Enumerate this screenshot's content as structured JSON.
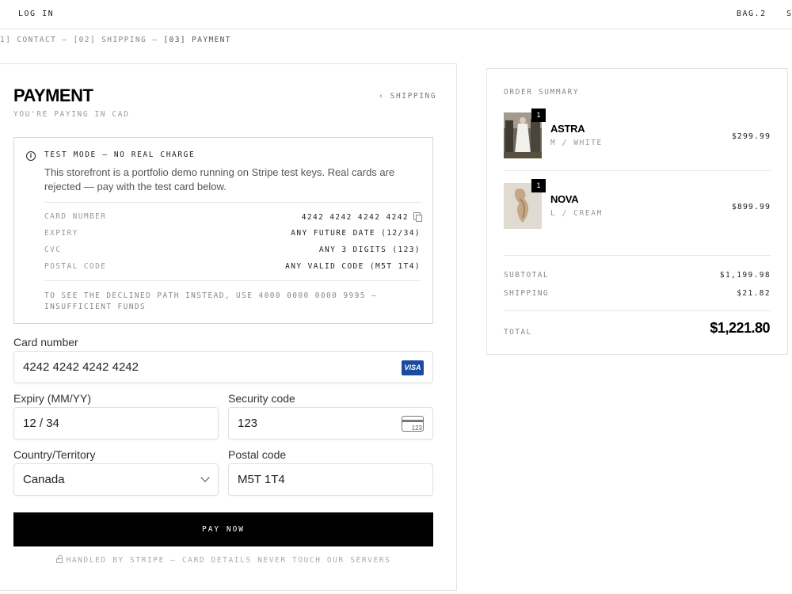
{
  "header": {
    "login": "LOG IN",
    "bag": "BAG.2",
    "cut_right": "S"
  },
  "steps": {
    "contact": "1] CONTACT",
    "sep1": " — ",
    "shipping": "[02] SHIPPING",
    "sep2": " — ",
    "payment": "[03] PAYMENT"
  },
  "payment": {
    "title": "PAYMENT",
    "subtitle": "YOU'RE PAYING IN CAD",
    "back_link": "SHIPPING",
    "notice": {
      "heading": "TEST MODE — NO REAL CHARGE",
      "body": "This storefront is a portfolio demo running on Stripe test keys. Real cards are rejected — pay with the test card below.",
      "rows": [
        {
          "key": "CARD NUMBER",
          "value": "4242 4242 4242 4242"
        },
        {
          "key": "EXPIRY",
          "value": "ANY FUTURE DATE (12/34)"
        },
        {
          "key": "CVC",
          "value": "ANY 3 DIGITS (123)"
        },
        {
          "key": "POSTAL CODE",
          "value": "ANY VALID CODE (M5T 1T4)"
        }
      ],
      "footer": "TO SEE THE DECLINED PATH INSTEAD, USE 4000 0000 0000 9995 — INSUFFICIENT FUNDS"
    },
    "fields": {
      "card_number_label": "Card number",
      "card_number_value": "4242 4242 4242 4242",
      "card_brand": "VISA",
      "expiry_label": "Expiry (MM/YY)",
      "expiry_value": "12 / 34",
      "security_label": "Security code",
      "security_value": "123",
      "security_icon_text": "123",
      "country_label": "Country/Territory",
      "country_value": "Canada",
      "postal_label": "Postal code",
      "postal_value": "M5T 1T4"
    },
    "pay_button": "PAY NOW",
    "secure_note": "HANDLED BY STRIPE — CARD DETAILS NEVER TOUCH OUR SERVERS"
  },
  "summary": {
    "heading": "ORDER SUMMARY",
    "items": [
      {
        "qty": "1",
        "name": "ASTRA",
        "variant": "M / WHITE",
        "price": "$299.99"
      },
      {
        "qty": "1",
        "name": "NOVA",
        "variant": "L / CREAM",
        "price": "$899.99"
      }
    ],
    "subtotal_label": "SUBTOTAL",
    "subtotal": "$1,199.98",
    "shipping_label": "SHIPPING",
    "shipping": "$21.82",
    "total_label": "TOTAL",
    "total": "$1,221.80"
  },
  "colors": {
    "accent": "#000000",
    "visa": "#1a4b9e"
  }
}
